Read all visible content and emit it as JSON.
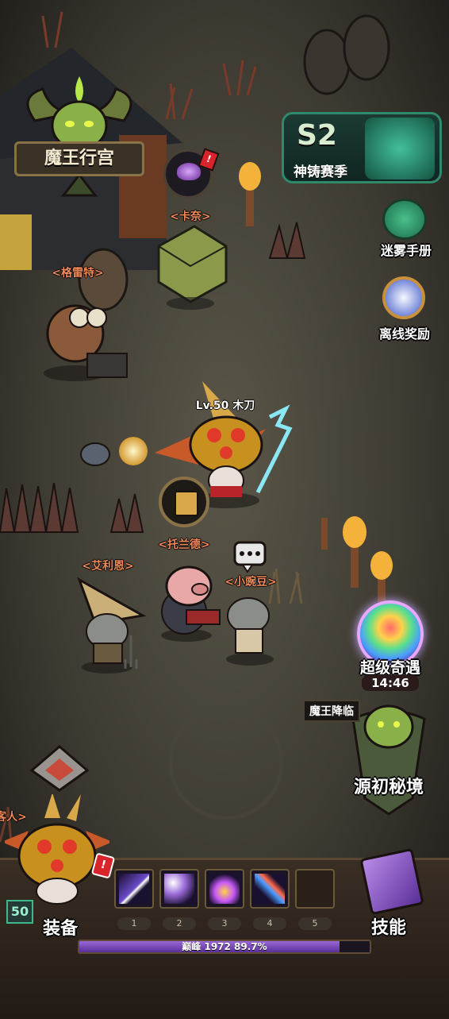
{
  "top_left": {
    "title": "魔王行宫"
  },
  "season_banner": {
    "season": "S2",
    "subtitle": "神铸赛季"
  },
  "right_menu": {
    "fog_handbook": "迷雾手册",
    "offline_reward": "离线奖励",
    "super_encounter": "超级奇遇",
    "super_encounter_timer": "14:46",
    "demon_king_tag": "魔王降临",
    "origin_realm": "源初秘境"
  },
  "npcs": {
    "kana": "<卡奈>",
    "gret": "<格雷特>",
    "toland": "<托兰德>",
    "erion": "<艾利恩>",
    "pea": "<小豌豆>",
    "partial_left": "客人>"
  },
  "player": {
    "label": "Lv.50 木刀"
  },
  "bottom": {
    "equip_label": "装备",
    "level": "50",
    "skills_label": "技能",
    "slot_numbers": [
      "1",
      "2",
      "3",
      "4",
      "5"
    ],
    "exp_text": "巅峰 1972  89.7%",
    "exp_progress": 0.897
  },
  "colors": {
    "name_tag": "#f08a58",
    "accent_green": "#3fb88a",
    "exp_purple": "#9a68d8",
    "alert_red": "#d8242a"
  }
}
